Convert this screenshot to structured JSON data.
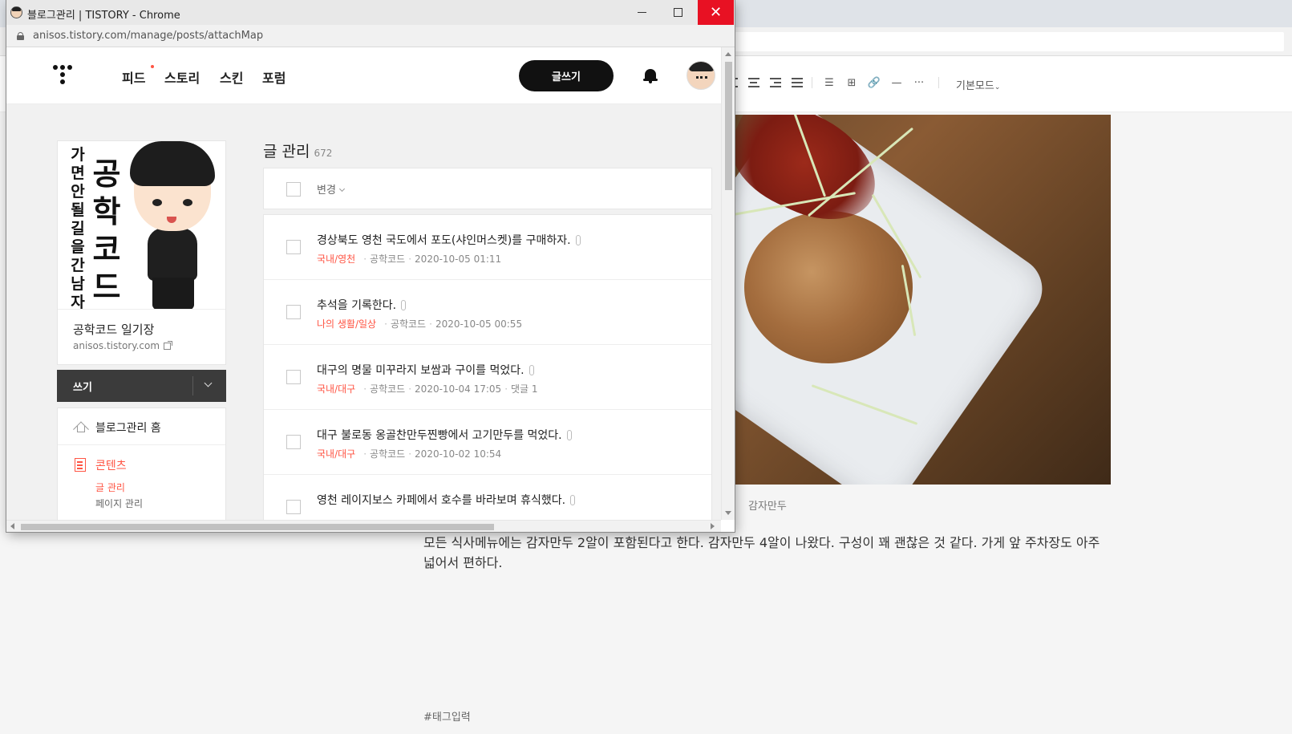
{
  "window": {
    "title": "블로그관리 | TISTORY - Chrome",
    "url": "anisos.tistory.com/manage/posts/attachMap"
  },
  "editor": {
    "mode_label": "기본모드",
    "image_caption": "감자만두",
    "body_text": "모든 식사메뉴에는 감자만두 2알이 포함된다고 한다. 감자만두 4알이 나왔다. 구성이 꽤 괜찮은 것 같다. 가게 앞 주차장도 아주 넓어서 편하다.",
    "tag_placeholder": "#태그입력"
  },
  "header": {
    "nav": [
      "피드",
      "스토리",
      "스킨",
      "포럼"
    ],
    "write_button": "글쓰기"
  },
  "sidebar": {
    "blog_image_text_small": "가면안될길을간남자",
    "blog_image_text_big": "공학코드",
    "blog_name": "공학코드 일기장",
    "blog_url": "anisos.tistory.com",
    "write_label": "쓰기",
    "home_label": "블로그관리 홈",
    "content_label": "콘텐츠",
    "submenu_active": "글 관리",
    "submenu_next": "페이지 관리"
  },
  "posts": {
    "title": "글 관리",
    "count": "672",
    "change_label": "변경",
    "items": [
      {
        "title": "경상북도 영천 국도에서 포도(샤인머스켓)를 구매하자.",
        "category": "국내/영천",
        "author": "공학코드",
        "date": "2020-10-05 01:11",
        "comments": ""
      },
      {
        "title": "추석을 기록한다.",
        "category": "나의 생활/일상",
        "author": "공학코드",
        "date": "2020-10-05 00:55",
        "comments": ""
      },
      {
        "title": "대구의 명물 미꾸라지 보쌈과 구이를 먹었다.",
        "category": "국내/대구",
        "author": "공학코드",
        "date": "2020-10-04 17:05",
        "comments": "댓글 1"
      },
      {
        "title": "대구 불로동 옹골찬만두찐빵에서 고기만두를 먹었다.",
        "category": "국내/대구",
        "author": "공학코드",
        "date": "2020-10-02 10:54",
        "comments": ""
      },
      {
        "title": "영천 레이지보스 카페에서 호수를 바라보며 휴식했다.",
        "category": "",
        "author": "",
        "date": "",
        "comments": ""
      }
    ]
  },
  "colors": {
    "accent": "#ff5544",
    "close_button": "#e81123",
    "write_button_bg": "#111111"
  }
}
